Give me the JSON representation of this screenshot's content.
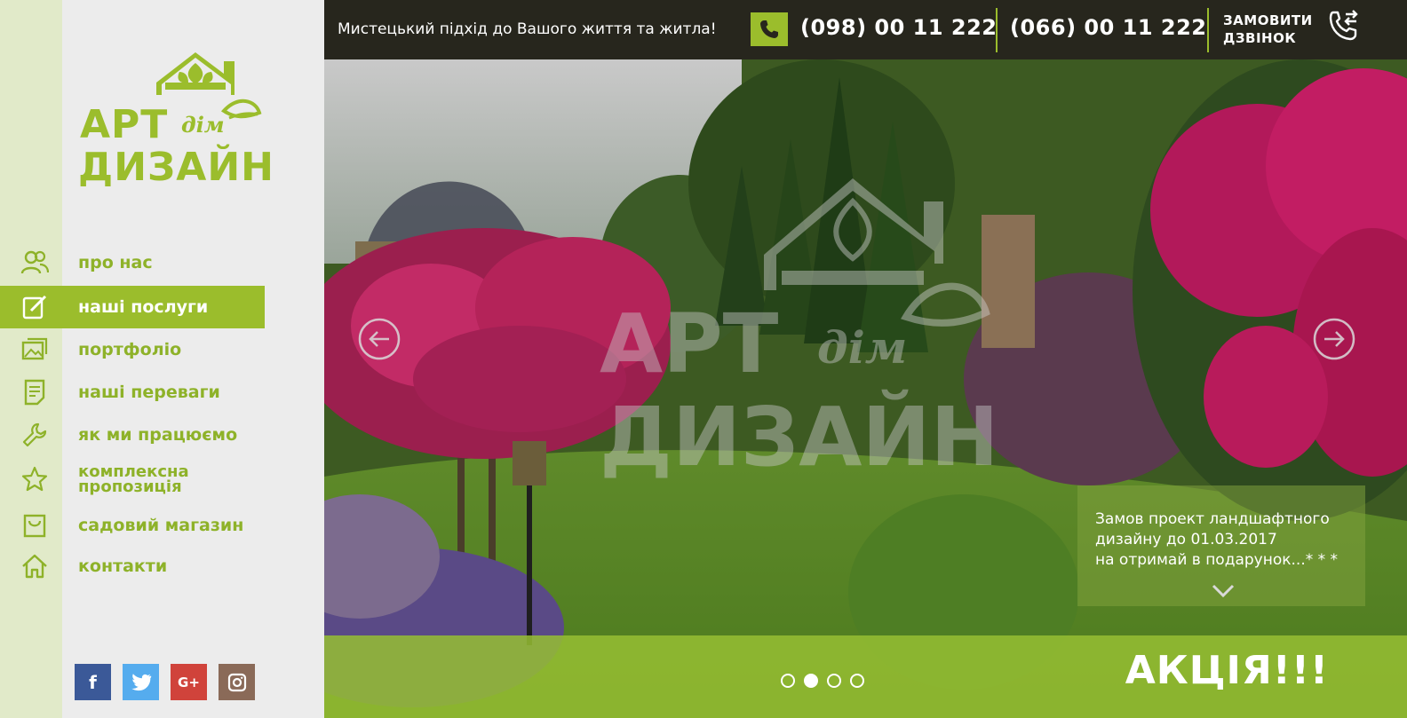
{
  "topbar": {
    "tagline": "Мистецький підхід до Вашого життя та житла!",
    "phone1": "(098) 00 11 222",
    "phone2": "(066) 00 11 222",
    "order_line1": "ЗАМОВИТИ",
    "order_line2": "ДЗВІНОК"
  },
  "logo": {
    "line1": "АРТ",
    "accent": "дім",
    "line2": "ДИЗАЙН"
  },
  "nav": {
    "items": [
      {
        "label": "про нас",
        "icon": "users-icon"
      },
      {
        "label": "наші послуги",
        "icon": "edit-icon",
        "active": true
      },
      {
        "label": "портфоліо",
        "icon": "gallery-icon"
      },
      {
        "label": "наші переваги",
        "icon": "document-icon"
      },
      {
        "label": "як ми працюємо",
        "icon": "wrench-icon"
      },
      {
        "label_line1": "комплексна",
        "label_line2": "пропозиція",
        "icon": "star-icon"
      },
      {
        "label": "садовий магазин",
        "icon": "shopping-bag-icon"
      },
      {
        "label": "контакти",
        "icon": "home-icon"
      }
    ]
  },
  "social": {
    "facebook": "f",
    "google_plus": "G+"
  },
  "hero": {
    "watermark_line1": "АРТ",
    "watermark_accent": "дім",
    "watermark_line2": "ДИЗАЙН",
    "promo_line1": "Замов проект ландшафтного",
    "promo_line2": "дизайну до 01.03.2017",
    "promo_line3": "на отримай в подарунок...* * *",
    "action_title": "АКЦІЯ!!!",
    "slide_count": 4,
    "active_slide": 2
  },
  "colors": {
    "accent": "#9bbd2c",
    "topbar_bg": "#27261d",
    "sidebar_bg": "#ececec",
    "rail_bg": "#e1eac9"
  }
}
